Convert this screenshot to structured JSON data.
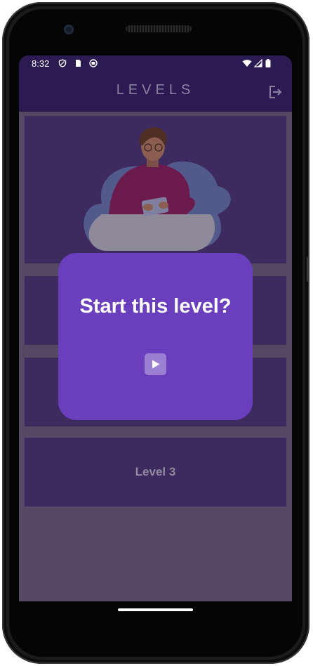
{
  "status_bar": {
    "time": "8:32",
    "left_icons": [
      "shield-icon",
      "sim-card-icon",
      "app-notification-icon"
    ],
    "right_icons": [
      "wifi-icon",
      "signal-icon",
      "battery-icon"
    ]
  },
  "app_bar": {
    "title": "LEVELS",
    "logout_icon": "logout-icon"
  },
  "levels": [
    {
      "label": "",
      "has_illustration": true
    },
    {
      "label": ""
    },
    {
      "label": ""
    },
    {
      "label": "Level 3"
    }
  ],
  "dialog": {
    "title": "Start this level?",
    "play_icon": "play-icon"
  },
  "colors": {
    "app_bar": "#2a1b52",
    "screen_background": "#544964",
    "card": "#3d2a5e",
    "dialog": "#6a3fbd",
    "play_button": "#9a7fd3"
  }
}
